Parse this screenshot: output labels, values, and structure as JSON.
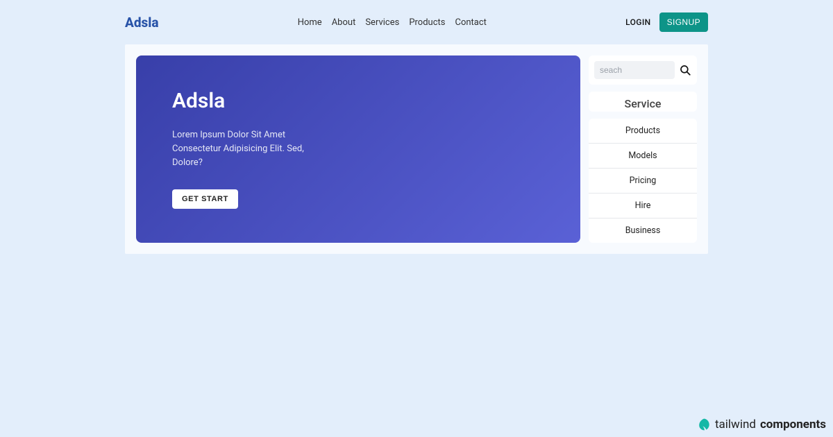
{
  "header": {
    "brand": "Adsla",
    "nav": [
      "Home",
      "About",
      "Services",
      "Products",
      "Contact"
    ],
    "login": "LOGIN",
    "signup": "SIGNUP"
  },
  "hero": {
    "title": "Adsla",
    "subtitle": "Lorem Ipsum Dolor Sit Amet Consectetur Adipisicing Elit. Sed, Dolore?",
    "cta": "GET START"
  },
  "search": {
    "placeholder": "seach"
  },
  "sidebar": {
    "title": "Service",
    "items": [
      "Products",
      "Models",
      "Pricing",
      "Hire",
      "Business"
    ]
  },
  "footer": {
    "word1": "tailwind",
    "word2": "components"
  }
}
